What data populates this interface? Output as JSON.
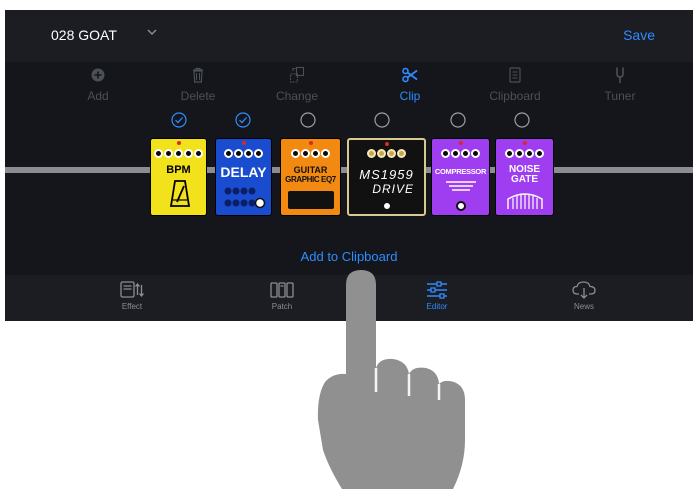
{
  "header": {
    "patch_name": "028 GOAT",
    "save_label": "Save"
  },
  "toolbar": {
    "items": [
      {
        "label": "Add",
        "icon": "plus-circle-icon",
        "active": false
      },
      {
        "label": "Delete",
        "icon": "trash-icon",
        "active": false
      },
      {
        "label": "Change",
        "icon": "change-icon",
        "active": false
      },
      {
        "label": "Clip",
        "icon": "scissors-icon",
        "active": true
      },
      {
        "label": "Clipboard",
        "icon": "clipboard-icon",
        "active": false
      },
      {
        "label": "Tuner",
        "icon": "tuner-icon",
        "active": false
      }
    ]
  },
  "chain": {
    "pedals": [
      {
        "name": "BPM",
        "color": "#f2e21c",
        "selected": true
      },
      {
        "name": "DELAY",
        "color": "#1a4ccf",
        "selected": true
      },
      {
        "name": "GUITAR GRAPHIC EQ7",
        "name_line1": "GUITAR",
        "name_line2": "GRAPHIC EQ7",
        "color": "#f28a12",
        "selected": false
      },
      {
        "name": "MS1959 DRIVE",
        "name_line1": "MS1959",
        "name_line2": "DRIVE",
        "color": "#111111",
        "selected": false
      },
      {
        "name": "COMPRESSOR",
        "color": "#9f3ef0",
        "selected": false
      },
      {
        "name": "NOISE GATE",
        "name_line1": "NOISE",
        "name_line2": "GATE",
        "color": "#9f3ef0",
        "selected": false
      }
    ]
  },
  "action": {
    "add_to_clipboard": "Add to Clipboard"
  },
  "tabs": [
    {
      "label": "Effect",
      "icon": "effect-icon",
      "active": false
    },
    {
      "label": "Patch",
      "icon": "patch-icon",
      "active": false
    },
    {
      "label": "Editor",
      "icon": "sliders-icon",
      "active": true
    },
    {
      "label": "News",
      "icon": "cloud-download-icon",
      "active": false
    }
  ],
  "colors": {
    "accent": "#2f8cff",
    "background": "#14161b",
    "bar": "#1b1d22",
    "disabled": "#4b5057"
  }
}
